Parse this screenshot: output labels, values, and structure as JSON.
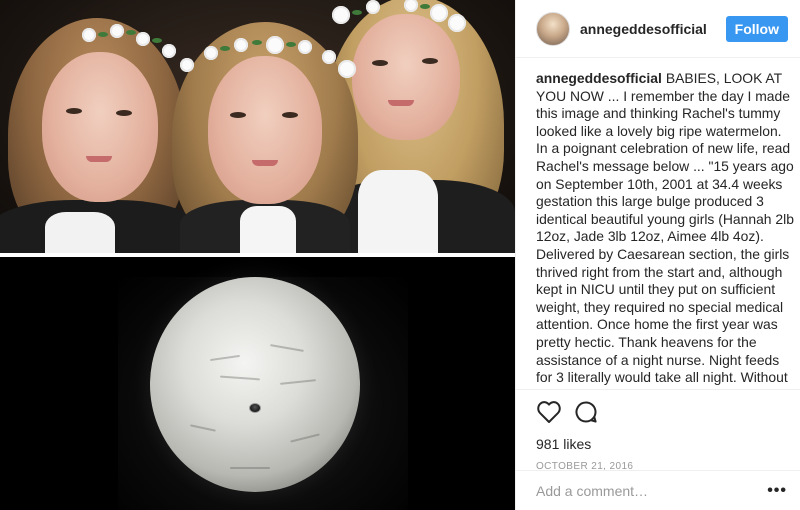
{
  "post": {
    "username": "annegeddesofficial",
    "follow_label": "Follow",
    "caption": {
      "username": "annegeddesofficial",
      "text": "BABIES, LOOK AT YOU NOW ... I remember the day I made this image and thinking Rachel's tummy looked like a lovely big ripe watermelon. In a poignant celebration of new life, read Rachel's message below ... \"15 years ago on September 10th, 2001 at 34.4 weeks gestation this large bulge produced 3 identical beautiful young girls (Hannah 2lb 12oz, Jade 3lb 12oz, Aimee 4lb 4oz). Delivered by Caesarean section, the girls thrived right from the start and, although kept in NICU until they put on sufficient weight, they required no special medical attention. Once home the first year was pretty hectic. Thank heavens for the assistance of a night nurse. Night feeds for 3 literally would take all night. Without the nurse nobody would have got any sleep and the days would be difficult to cope with as well. Over the three"
    },
    "likes": "981 likes",
    "date": "October 21, 2016",
    "comment_placeholder": "Add a comment…",
    "more_label": "•••",
    "icons": {
      "like": "heart-icon",
      "comment": "comment-bubble-icon"
    },
    "colors": {
      "follow_button": "#3897f0",
      "border": "#efefef",
      "muted_text": "#999999"
    }
  }
}
